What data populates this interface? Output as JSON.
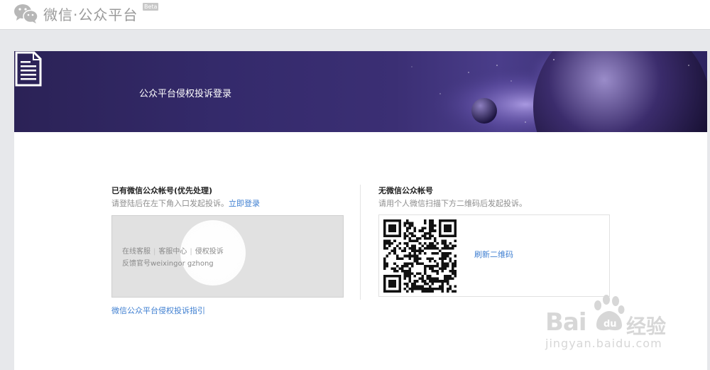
{
  "header": {
    "logo_text": "微信·公众平台",
    "beta_badge": "Beta"
  },
  "banner": {
    "title": "公众平台侵权投诉登录"
  },
  "left": {
    "title": "已有微信公众帐号(优先处理)",
    "desc": "请登陆后在左下角入口发起投诉。",
    "login_link": "立即登录",
    "preview": {
      "item1": "在线客服",
      "item2": "客服中心",
      "item3": "侵权投诉",
      "line2": "反馈官号weixingor gzhong"
    },
    "guide_link": "微信公众平台侵权投诉指引"
  },
  "right": {
    "title": "无微信公众帐号",
    "desc": "请用个人微信扫描下方二维码后发起投诉。",
    "refresh_link": "刷新二维码"
  },
  "watermark": {
    "brand": "Bai",
    "brand_cn": "经验",
    "url": "jingyan.baidu.com"
  }
}
